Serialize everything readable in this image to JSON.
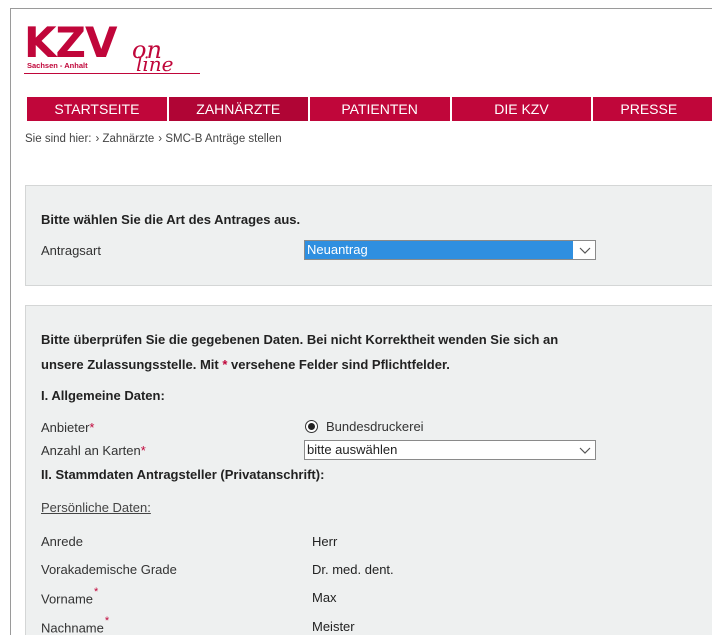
{
  "brand": {
    "kzv": "KZV",
    "region": "Sachsen - Anhalt",
    "on": "on",
    "line": "line",
    "color": "#c0063a"
  },
  "nav": {
    "items": [
      {
        "label": "STARTSEITE"
      },
      {
        "label": "ZAHNÄRZTE"
      },
      {
        "label": "PATIENTEN"
      },
      {
        "label": "DIE KZV"
      },
      {
        "label": "PRESSE"
      }
    ]
  },
  "breadcrumb": {
    "prefix": "Sie sind hier:",
    "items": [
      "› Zahnärzte",
      "› SMC-B Anträge stellen"
    ]
  },
  "panel1": {
    "heading": "Bitte wählen Sie die Art des Antrages aus.",
    "antragsart_label": "Antragsart",
    "antragsart_value": "Neuantrag"
  },
  "panel2": {
    "intro_line1": "Bitte überprüfen Sie die gegebenen Daten. Bei nicht Korrektheit wenden Sie sich an",
    "intro_line2_a": "unsere Zulassungsstelle. Mit ",
    "intro_star": "*",
    "intro_line2_b": " versehene Felder sind Pflichtfelder.",
    "section1": "I. Allgemeine Daten:",
    "anbieter_label": "Anbieter",
    "anbieter_option": "Bundesdruckerei",
    "karten_label": "Anzahl an Karten",
    "karten_value": "bitte auswählen",
    "section2": "II. Stammdaten Antragsteller (Privatanschrift):",
    "personal_heading": "Persönliche Daten:",
    "anrede_label": "Anrede",
    "anrede_value": "Herr",
    "grade_label": "Vorakademische Grade",
    "grade_value": "Dr. med. dent.",
    "vorname_label": "Vorname",
    "vorname_value": "Max",
    "nachname_label": "Nachname",
    "nachname_value": "Meister",
    "required_mark": "*"
  }
}
